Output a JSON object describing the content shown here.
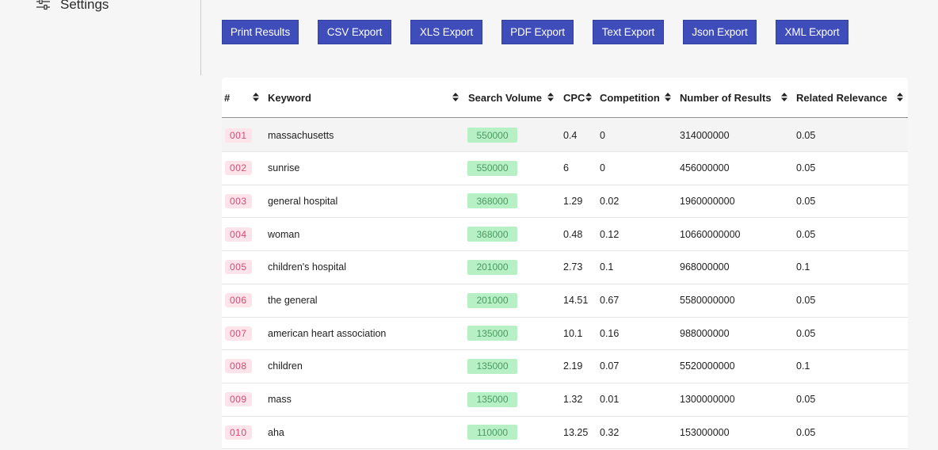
{
  "sidebar": {
    "settings_label": "Settings",
    "settings_icon": "sliders-icon"
  },
  "toolbar": {
    "buttons": [
      {
        "label": "Print Results"
      },
      {
        "label": "CSV Export"
      },
      {
        "label": "XLS Export"
      },
      {
        "label": "PDF Export"
      },
      {
        "label": "Text Export"
      },
      {
        "label": "Json Export"
      },
      {
        "label": "XML Export"
      }
    ]
  },
  "colors": {
    "button_bg": "#3f4dbb",
    "index_badge_bg": "#fde4ea",
    "index_badge_text": "#d54a72",
    "volume_badge_bg": "#b8f0c6",
    "volume_badge_text": "#4a9a62"
  },
  "table": {
    "headers": {
      "index": "#",
      "keyword": "Keyword",
      "search_volume": "Search Volume",
      "cpc": "CPC",
      "competition": "Competition",
      "number_of_results": "Number of Results",
      "related_relevance": "Related Relevance"
    },
    "rows": [
      {
        "index": "001",
        "keyword": "massachusetts",
        "volume": "550000",
        "cpc": "0.4",
        "competition": "0",
        "results": "314000000",
        "relevance": "0.05"
      },
      {
        "index": "002",
        "keyword": "sunrise",
        "volume": "550000",
        "cpc": "6",
        "competition": "0",
        "results": "456000000",
        "relevance": "0.05"
      },
      {
        "index": "003",
        "keyword": "general hospital",
        "volume": "368000",
        "cpc": "1.29",
        "competition": "0.02",
        "results": "1960000000",
        "relevance": "0.05"
      },
      {
        "index": "004",
        "keyword": "woman",
        "volume": "368000",
        "cpc": "0.48",
        "competition": "0.12",
        "results": "10660000000",
        "relevance": "0.05"
      },
      {
        "index": "005",
        "keyword": "children's hospital",
        "volume": "201000",
        "cpc": "2.73",
        "competition": "0.1",
        "results": "968000000",
        "relevance": "0.1"
      },
      {
        "index": "006",
        "keyword": "the general",
        "volume": "201000",
        "cpc": "14.51",
        "competition": "0.67",
        "results": "5580000000",
        "relevance": "0.05"
      },
      {
        "index": "007",
        "keyword": "american heart association",
        "volume": "135000",
        "cpc": "10.1",
        "competition": "0.16",
        "results": "988000000",
        "relevance": "0.05"
      },
      {
        "index": "008",
        "keyword": "children",
        "volume": "135000",
        "cpc": "2.19",
        "competition": "0.07",
        "results": "5520000000",
        "relevance": "0.1"
      },
      {
        "index": "009",
        "keyword": "mass",
        "volume": "135000",
        "cpc": "1.32",
        "competition": "0.01",
        "results": "1300000000",
        "relevance": "0.05"
      },
      {
        "index": "010",
        "keyword": "aha",
        "volume": "110000",
        "cpc": "13.25",
        "competition": "0.32",
        "results": "153000000",
        "relevance": "0.05"
      }
    ]
  }
}
